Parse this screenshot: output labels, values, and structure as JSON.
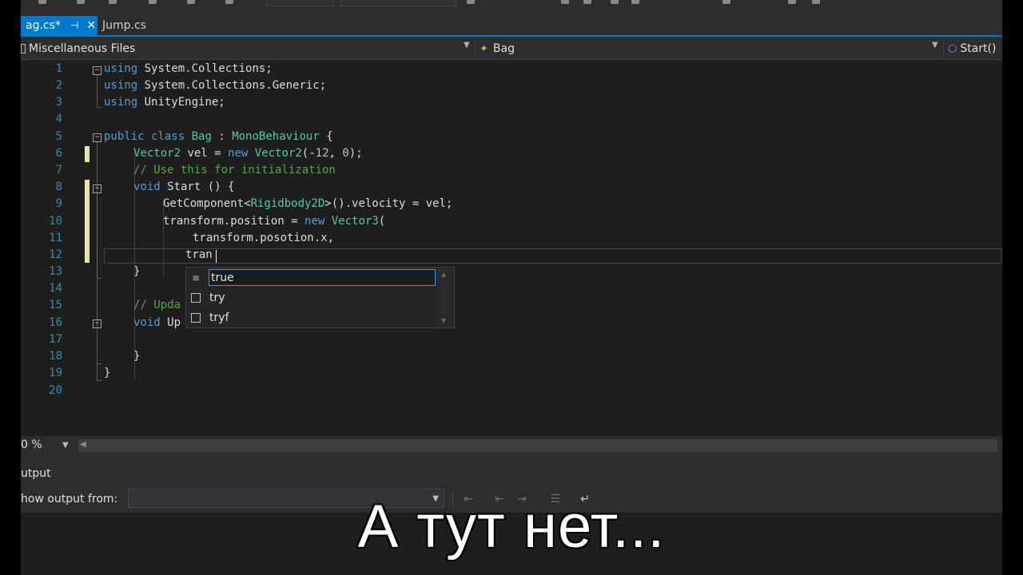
{
  "tabs": [
    {
      "label": "ag.cs*",
      "active": true
    },
    {
      "label": "Jump.cs",
      "active": false
    }
  ],
  "navbar": {
    "project": "Miscellaneous Files",
    "class": "Bag",
    "member": "Start()"
  },
  "editor": {
    "line_numbers": [
      "1",
      "2",
      "3",
      "4",
      "5",
      "6",
      "7",
      "8",
      "9",
      "10",
      "11",
      "12",
      "13",
      "14",
      "15",
      "16",
      "17",
      "18",
      "19",
      "20"
    ],
    "code": {
      "l1_kw": "using",
      "l1_rest": " System.Collections;",
      "l2_kw": "using",
      "l2_rest": " System.Collections.Generic;",
      "l3_kw": "using",
      "l3_rest": " UnityEngine;",
      "l5_kw1": "public",
      "l5_kw2": "class",
      "l5_cls": "Bag",
      "l5_sep": " : ",
      "l5_base": "MonoBehaviour",
      "l5_end": " {",
      "l6_type": "Vector2",
      "l6_mid": " vel = ",
      "l6_new": "new",
      "l6_type2": "Vector2",
      "l6_args_open": "(-",
      "l6_n1": "12",
      "l6_comma": ", ",
      "l6_n2": "0",
      "l6_end": ");",
      "l7_comment": "// Use this for initialization",
      "l8_kw": "void",
      "l8_rest": " Start () {",
      "l9_a": "GetComponent<",
      "l9_type": "Rigidbody2D",
      "l9_b": ">().velocity = vel;",
      "l10_a": "transform.position = ",
      "l10_new": "new",
      "l10_type": "Vector3",
      "l10_b": "(",
      "l11": "transform.posotion.x,",
      "l12": "tran",
      "l13": "}",
      "l15_comment": "// Upda",
      "l16_kw": "void",
      "l16_rest": " Up",
      "l18": "}",
      "l19": "}"
    }
  },
  "completion": {
    "items": [
      {
        "label": "true",
        "icon": "keyword-icon",
        "selected": true
      },
      {
        "label": "try",
        "icon": "snippet-icon",
        "selected": false
      },
      {
        "label": "tryf",
        "icon": "snippet-icon",
        "selected": false
      }
    ]
  },
  "status": {
    "zoom": "0 %"
  },
  "output": {
    "title": "utput",
    "show_from": "how output from:"
  },
  "subtitle": "А тут нет...",
  "colors": {
    "accent": "#007acc",
    "keyword": "#569cd6",
    "type": "#4ec9b0",
    "comment": "#57a64a",
    "number": "#b5cea8",
    "line_number": "#2b91af"
  }
}
